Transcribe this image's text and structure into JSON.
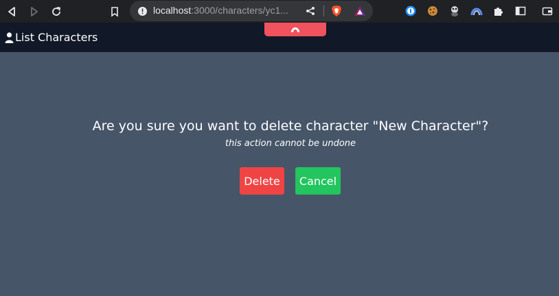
{
  "browser": {
    "url_host": "localhost",
    "url_path": ":3000/characters/yc1...",
    "back_icon": "back-triangle-icon",
    "forward_icon": "forward-triangle-icon",
    "reload_icon": "reload-icon",
    "bookmark_icon": "bookmark-icon"
  },
  "header": {
    "link_label": "List Characters",
    "link_icon": "user-icon"
  },
  "dialog": {
    "title": "Are you sure you want to delete character \"New Character\"?",
    "subtitle": "this action cannot be undone",
    "delete_label": "Delete",
    "cancel_label": "Cancel"
  },
  "colors": {
    "page_bg": "#475569",
    "header_bg": "#111827",
    "delete": "#ef4444",
    "cancel": "#22c55e",
    "floating_tab": "#f0525e"
  }
}
